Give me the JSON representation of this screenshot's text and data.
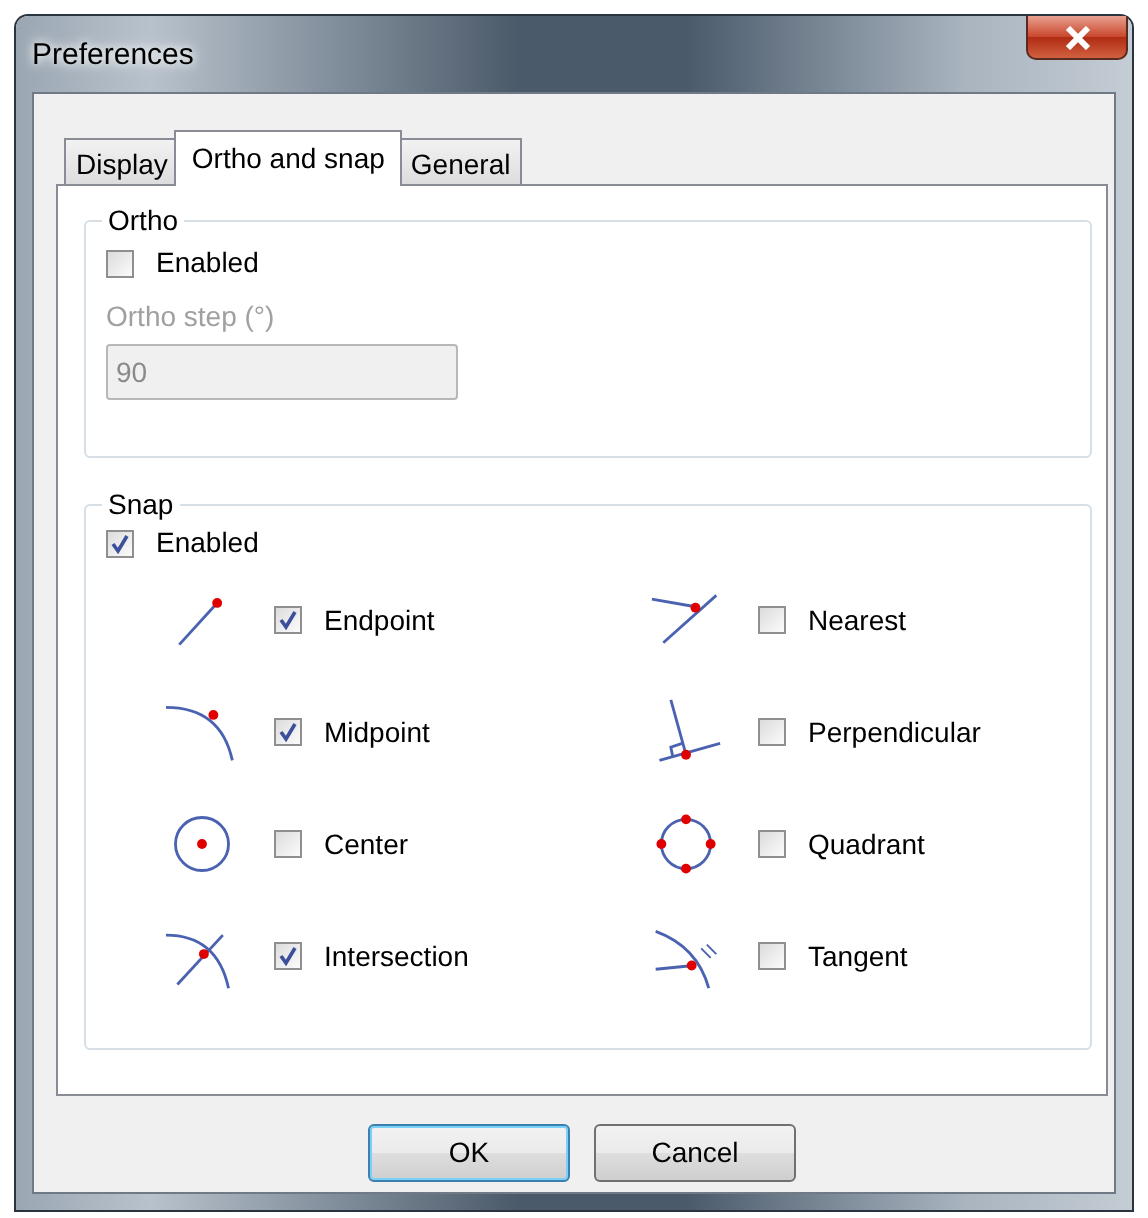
{
  "window": {
    "title": "Preferences"
  },
  "tabs": [
    {
      "label": "Display",
      "selected": false
    },
    {
      "label": "Ortho and snap",
      "selected": true
    },
    {
      "label": "General",
      "selected": false
    }
  ],
  "ortho": {
    "legend": "Ortho",
    "enabled": {
      "label": "Enabled",
      "checked": false
    },
    "step": {
      "label": "Ortho step (°)",
      "value": "90",
      "disabled": true
    }
  },
  "snap": {
    "legend": "Snap",
    "enabled": {
      "label": "Enabled",
      "checked": true
    },
    "modes": [
      {
        "kind": "endpoint",
        "label": "Endpoint",
        "checked": true
      },
      {
        "kind": "nearest",
        "label": "Nearest",
        "checked": false
      },
      {
        "kind": "midpoint",
        "label": "Midpoint",
        "checked": true
      },
      {
        "kind": "perpendicular",
        "label": "Perpendicular",
        "checked": false
      },
      {
        "kind": "center",
        "label": "Center",
        "checked": false
      },
      {
        "kind": "quadrant",
        "label": "Quadrant",
        "checked": false
      },
      {
        "kind": "intersection",
        "label": "Intersection",
        "checked": true
      },
      {
        "kind": "tangent",
        "label": "Tangent",
        "checked": false
      }
    ]
  },
  "buttons": [
    {
      "label": "OK",
      "default": true
    },
    {
      "label": "Cancel",
      "default": false
    }
  ]
}
